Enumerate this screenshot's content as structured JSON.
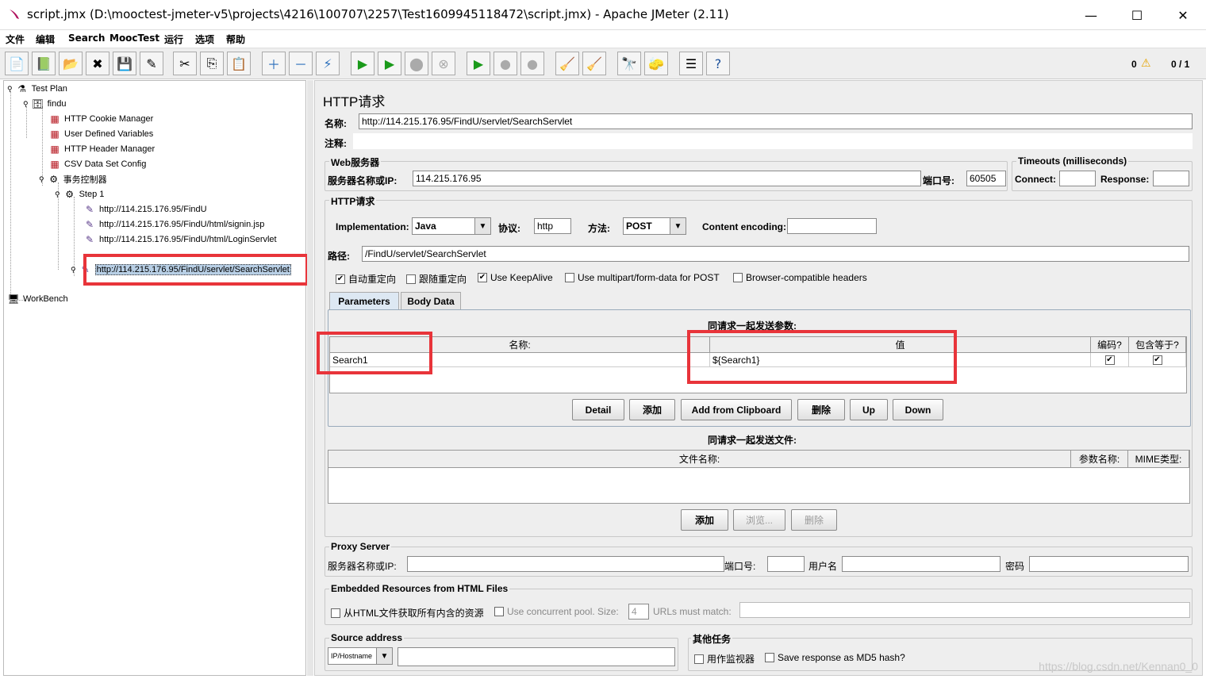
{
  "window": {
    "title": "script.jmx (D:\\mooctest-jmeter-v5\\projects\\4216\\100707\\2257\\Test1609945118472\\script.jmx) - Apache JMeter (2.11)",
    "minimize": "—",
    "maximize": "☐",
    "close": "✕"
  },
  "menu": [
    "文件",
    "编辑",
    "Search",
    "MoocTest",
    "运行",
    "选项",
    "帮助"
  ],
  "status": {
    "errors": "0",
    "threads": "0 / 1"
  },
  "tree": {
    "nodes": [
      {
        "label": "Test Plan",
        "icon": "flask-icon"
      },
      {
        "label": "findu",
        "icon": "thread-group-icon"
      },
      {
        "label": "HTTP Cookie Manager",
        "icon": "config-icon"
      },
      {
        "label": "User Defined Variables",
        "icon": "config-icon"
      },
      {
        "label": "HTTP Header Manager",
        "icon": "config-icon"
      },
      {
        "label": "CSV Data Set Config",
        "icon": "config-icon"
      },
      {
        "label": "事务控制器",
        "icon": "controller-icon"
      },
      {
        "label": "Step 1",
        "icon": "controller-icon"
      },
      {
        "label": "http://114.215.176.95/FindU",
        "icon": "sampler-icon"
      },
      {
        "label": "http://114.215.176.95/FindU/html/signin.jsp",
        "icon": "sampler-icon"
      },
      {
        "label": "http://114.215.176.95/FindU/html/LoginServlet",
        "icon": "sampler-icon"
      },
      {
        "label": "http://114.215.176.95/FindU/servlet/SearchServlet",
        "icon": "sampler-icon"
      },
      {
        "label": "WorkBench",
        "icon": "workbench-icon"
      }
    ]
  },
  "panel": {
    "title": "HTTP请求",
    "name_label": "名称:",
    "name_value": "http://114.215.176.95/FindU/servlet/SearchServlet",
    "comment_label": "注释:",
    "web_server": {
      "group": "Web服务器",
      "server_label": "服务器名称或IP:",
      "server_value": "114.215.176.95",
      "port_label": "端口号:",
      "port_value": "60505"
    },
    "timeouts": {
      "group": "Timeouts (milliseconds)",
      "connect_label": "Connect:",
      "response_label": "Response:"
    },
    "http_request": {
      "group": "HTTP请求",
      "impl_label": "Implementation:",
      "impl_value": "Java",
      "protocol_label": "协议:",
      "protocol_value": "http",
      "method_label": "方法:",
      "method_value": "POST",
      "encoding_label": "Content encoding:",
      "path_label": "路径:",
      "path_value": "/FindU/servlet/SearchServlet",
      "options": [
        {
          "label": "自动重定向",
          "checked": true
        },
        {
          "label": "跟随重定向",
          "checked": false
        },
        {
          "label": "Use KeepAlive",
          "checked": true
        },
        {
          "label": "Use multipart/form-data for POST",
          "checked": false
        },
        {
          "label": "Browser-compatible headers",
          "checked": false
        }
      ]
    },
    "tabs": [
      "Parameters",
      "Body Data"
    ],
    "params": {
      "caption": "同请求一起发送参数:",
      "headers": [
        "名称:",
        "值",
        "编码?",
        "包含等于?"
      ],
      "rows": [
        {
          "name": "Search1",
          "value": "${Search1}",
          "encode": true,
          "include_equals": true
        }
      ],
      "buttons": [
        "Detail",
        "添加",
        "Add from Clipboard",
        "删除",
        "Up",
        "Down"
      ]
    },
    "files": {
      "caption": "同请求一起发送文件:",
      "headers": [
        "文件名称:",
        "参数名称:",
        "MIME类型:"
      ],
      "buttons": [
        "添加",
        "浏览...",
        "删除"
      ]
    },
    "proxy": {
      "group": "Proxy Server",
      "server_label": "服务器名称或IP:",
      "port_label": "端口号:",
      "user_label": "用户名",
      "password_label": "密码"
    },
    "embedded": {
      "group": "Embedded Resources from HTML Files",
      "fetch_label": "从HTML文件获取所有内含的资源",
      "pool_label": "Use concurrent pool. Size:",
      "pool_value": "4",
      "urls_label": "URLs must match:"
    },
    "source": {
      "group": "Source address",
      "type_value": "IP/Hostname"
    },
    "other": {
      "group": "其他任务",
      "monitor_label": "用作监视器",
      "md5_label": "Save response as MD5 hash?"
    }
  },
  "watermark": "https://blog.csdn.net/Kennan0_0",
  "colors": {
    "highlight": "#e8343a",
    "selection": "#b8cfe5"
  }
}
